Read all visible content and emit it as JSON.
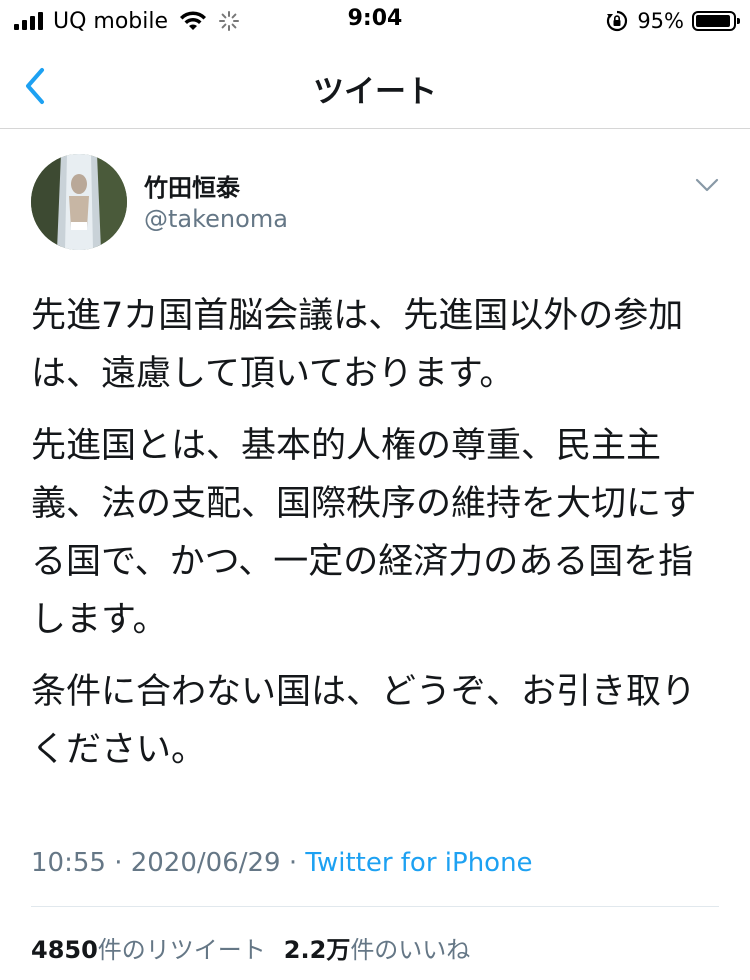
{
  "status_bar": {
    "carrier": "UQ mobile",
    "time": "9:04",
    "battery_percent": "95%",
    "battery_level": 0.95
  },
  "nav": {
    "title": "ツイート",
    "back_icon": "chevron-left-icon"
  },
  "tweet": {
    "author": {
      "display_name": "竹田恒泰",
      "handle": "@takenoma"
    },
    "paragraphs": [
      "先進7カ国首脳会議は、先進国以外の参加は、遠慮して頂いております。",
      "先進国とは、基本的人権の尊重、民主主義、法の支配、国際秩序の維持を大切にする国で、かつ、一定の経済力のある国を指します。",
      "条件に合わない国は、どうぞ、お引き取りください。"
    ],
    "timestamp": "10:55 · 2020/06/29 · ",
    "source": "Twitter for iPhone",
    "retweets_count": "4850",
    "retweets_label": "件のリツイート",
    "likes_count": "2.2万",
    "likes_label": "件のいいね"
  },
  "colors": {
    "link": "#1da1f2",
    "secondary_text": "#657786",
    "primary_text": "#14171a"
  }
}
